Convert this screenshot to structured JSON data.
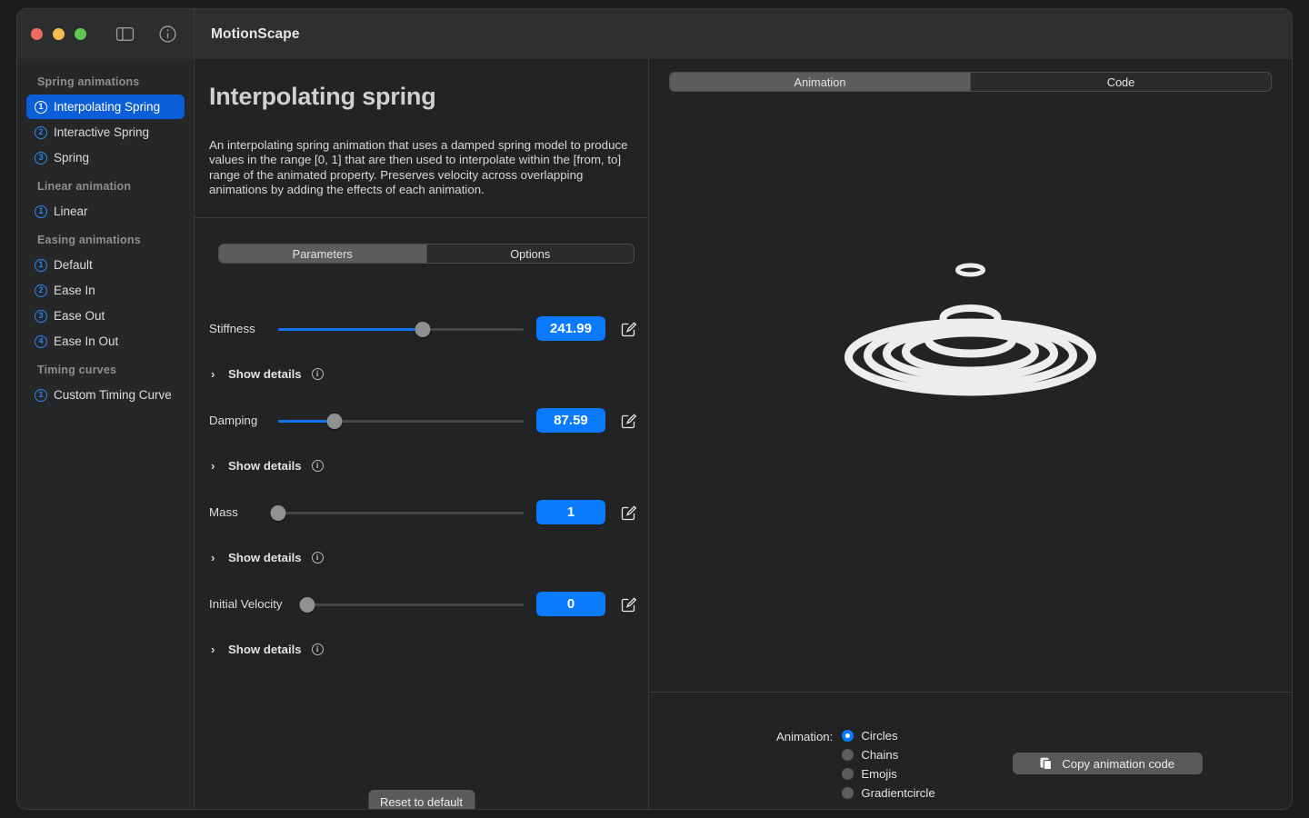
{
  "window": {
    "app_title": "MotionScape",
    "traffic_lights": [
      "close",
      "minimize",
      "zoom"
    ],
    "toolbar_icons": [
      "sidebar-toggle-icon",
      "info-icon"
    ]
  },
  "sidebar": {
    "groups": [
      {
        "title": "Spring animations",
        "items": [
          {
            "badge": "1",
            "label": "Interpolating Spring",
            "selected": true
          },
          {
            "badge": "2",
            "label": "Interactive Spring",
            "selected": false
          },
          {
            "badge": "3",
            "label": "Spring",
            "selected": false
          }
        ]
      },
      {
        "title": "Linear animation",
        "items": [
          {
            "badge": "1",
            "label": "Linear",
            "selected": false
          }
        ]
      },
      {
        "title": "Easing animations",
        "items": [
          {
            "badge": "1",
            "label": "Default",
            "selected": false
          },
          {
            "badge": "2",
            "label": "Ease In",
            "selected": false
          },
          {
            "badge": "3",
            "label": "Ease Out",
            "selected": false
          },
          {
            "badge": "4",
            "label": "Ease In Out",
            "selected": false
          }
        ]
      },
      {
        "title": "Timing curves",
        "items": [
          {
            "badge": "1",
            "label": "Custom Timing Curve",
            "selected": false
          }
        ]
      }
    ]
  },
  "detail": {
    "title": "Interpolating spring",
    "description": "An interpolating spring animation that uses a damped spring model to produce values in the range [0, 1] that are then used to interpolate within the [from, to] range of the animated property.\nPreserves velocity across overlapping animations by adding the effects of each animation.",
    "tabs": [
      {
        "label": "Parameters",
        "selected": true
      },
      {
        "label": "Options",
        "selected": false
      }
    ],
    "details_label": "Show details",
    "reset_label": "Reset to default",
    "parameters": [
      {
        "label": "Stiffness",
        "value": "241.99",
        "percent": 59
      },
      {
        "label": "Damping",
        "value": "87.59",
        "percent": 23
      },
      {
        "label": "Mass",
        "value": "1",
        "percent": 0
      },
      {
        "label": "Initial Velocity",
        "value": "0",
        "percent": 0
      }
    ]
  },
  "preview": {
    "tabs": [
      {
        "label": "Animation",
        "selected": true
      },
      {
        "label": "Code",
        "selected": false
      }
    ],
    "animation_label": "Animation:",
    "animation_options": [
      {
        "label": "Circles",
        "selected": true
      },
      {
        "label": "Chains",
        "selected": false
      },
      {
        "label": "Emojis",
        "selected": false
      },
      {
        "label": "Gradientcircle",
        "selected": false
      }
    ],
    "copy_label": "Copy animation code"
  },
  "colors": {
    "accent": "#0a7bff",
    "selection": "#0a5fd8",
    "slider_fill": "#1273f0",
    "window_bg": "#262729",
    "panel_bg": "#222325"
  }
}
